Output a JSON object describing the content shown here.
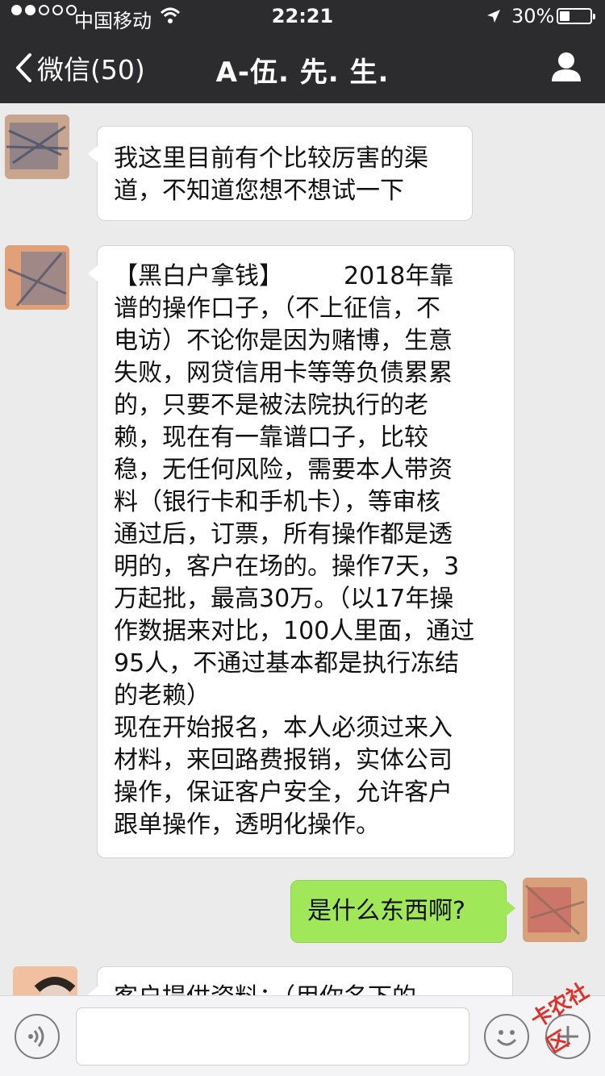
{
  "status_bar": {
    "carrier": "中国移动",
    "time": "22:21",
    "battery": "30%"
  },
  "nav": {
    "back_label": "微信(50)",
    "title": "A-伍. 先. 生."
  },
  "messages": [
    {
      "direction": "incoming",
      "lines": [
        "我这里目前有个比较厉害的渠",
        "道，不知道您想不想试一下"
      ]
    },
    {
      "direction": "incoming",
      "lines": [
        "【黑白户拿钱】　　　2018年靠",
        "谱的操作口子，（不上征信，不",
        "电访）不论你是因为赌博，生意",
        "失败，网贷信用卡等等负债累累",
        "的，只要不是被法院执行的老",
        "赖，现在有一靠谱口子，比较",
        "稳，无任何风险，需要本人带资",
        "料（银行卡和手机卡），等审核",
        "通过后，订票，所有操作都是透",
        "明的，客户在场的。操作7天，3",
        "万起批，最高30万。（以17年操",
        "作数据来对比，100人里面，通过",
        "95人，不通过基本都是执行冻结",
        "的老赖）",
        "现在开始报名，本人必须过来入",
        "材料，来回路费报销，实体公司",
        "操作，保证客户安全，允许客户",
        "跟单操作，透明化操作。"
      ]
    },
    {
      "direction": "outgoing",
      "lines": [
        "是什么东西啊?"
      ]
    },
    {
      "direction": "incoming",
      "lines": [
        "客户提供资料：（用你名下的"
      ]
    }
  ],
  "watermark": "卡农社区",
  "colors": {
    "nav_bg": "#2c2c2e",
    "chat_bg": "#ebebeb",
    "outgoing_bubble": "#a0e75a",
    "incoming_bubble": "#ffffff"
  },
  "icons": [
    "wifi-icon",
    "location-arrow-icon",
    "battery-icon",
    "back-chevron-icon",
    "profile-icon",
    "voice-icon",
    "emoji-icon",
    "plus-icon"
  ]
}
